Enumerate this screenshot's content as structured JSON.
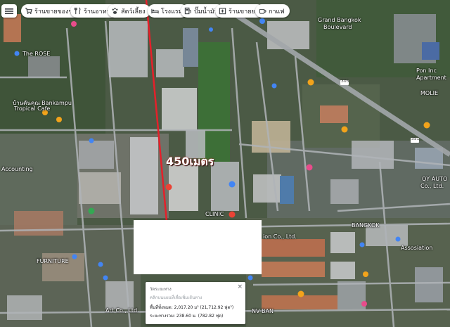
{
  "toolbar": {
    "menu_icon": "grid-menu-icon",
    "chips": [
      {
        "label": "ร้านขายของชำ",
        "icon": "cart-icon"
      },
      {
        "label": "ร้านอาหาร",
        "icon": "fork-knife-icon"
      },
      {
        "label": "สัตว์เลี้ยง",
        "icon": "pet-icon"
      },
      {
        "label": "โรงแรม",
        "icon": "bed-icon"
      },
      {
        "label": "ปั๊มน้ำมัน",
        "icon": "fuel-icon"
      },
      {
        "label": "ร้านขายยา",
        "icon": "pharmacy-icon"
      },
      {
        "label": "กาแฟ",
        "icon": "coffee-icon"
      }
    ]
  },
  "map_labels": [
    {
      "text": "The ROSE",
      "name": "label-the-rose"
    },
    {
      "text": "บ้านคันคุณ Bankampu",
      "name": "label-bankampu"
    },
    {
      "text": "Tropical Cafe",
      "name": "label-tropical-cafe"
    },
    {
      "text": "Grand Bangkok",
      "name": "label-grand-bangkok"
    },
    {
      "text": "Boulevard",
      "name": "label-boulevard"
    },
    {
      "text": "Pon Inc",
      "name": "label-pon-inc"
    },
    {
      "text": "Apartment",
      "name": "label-apartment"
    },
    {
      "text": "MOLIE",
      "name": "label-molie"
    },
    {
      "text": "QY AUTO",
      "name": "label-qy-auto"
    },
    {
      "text": "Co., Ltd.",
      "name": "label-co-ltd"
    },
    {
      "text": "Accounting",
      "name": "label-accounting"
    },
    {
      "text": "CLINIC",
      "name": "label-clinic"
    },
    {
      "text": "BANGKOK",
      "name": "label-bangkok"
    },
    {
      "text": "ion Co., Ltd.",
      "name": "label-ion-co"
    },
    {
      "text": "Assosiation",
      "name": "label-association"
    },
    {
      "text": "FURNITURE",
      "name": "label-furniture"
    },
    {
      "text": "Art Co., Ltd.",
      "name": "label-art-co"
    },
    {
      "text": "NV BAN",
      "name": "label-nv-ban"
    },
    {
      "text": "305",
      "name": "label-route-305"
    },
    {
      "text": "351",
      "name": "label-route-351"
    }
  ],
  "measure_overlay": {
    "distance_label": "450เมตร",
    "line_color": "#e5202a"
  },
  "measure_card": {
    "title": "วัดระยะทาง",
    "subtitle": "คลิกบนแผนที่เพื่อเพิ่มเส้นทาง",
    "area": "พื้นที่ทั้งหมด: 2,017.20 ม² (21,712.92 ฟุต²)",
    "distance": "ระยะทางรวม: 238.60 ม. (782.82 ฟุต)",
    "close_icon": "close-icon"
  },
  "colors": {
    "road_main": "#9aa0a6",
    "road_minor": "#b0b4b8",
    "pin_blue": "#4285f4",
    "pin_orange": "#f2a31b",
    "pin_pink": "#e84c8b",
    "pin_red": "#ea4335",
    "pin_green": "#34a853"
  }
}
